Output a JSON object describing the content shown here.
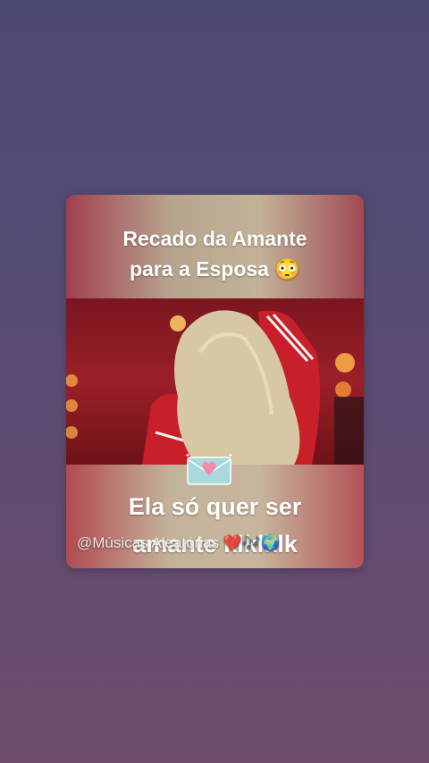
{
  "post": {
    "title_line1": "Recado da Amante",
    "title_line2": "para a Esposa 😳",
    "caption_line1": "Ela só quer ser",
    "caption_line2": "amante klklklk",
    "watermark": "@Músicas Aleatórias ❤️🎶🌍"
  },
  "icons": {
    "envelope": "love-letter-icon"
  },
  "colors": {
    "background_top": "#4b4a75",
    "background_bottom": "#6d4c6c",
    "video_red": "#9b1f28"
  }
}
